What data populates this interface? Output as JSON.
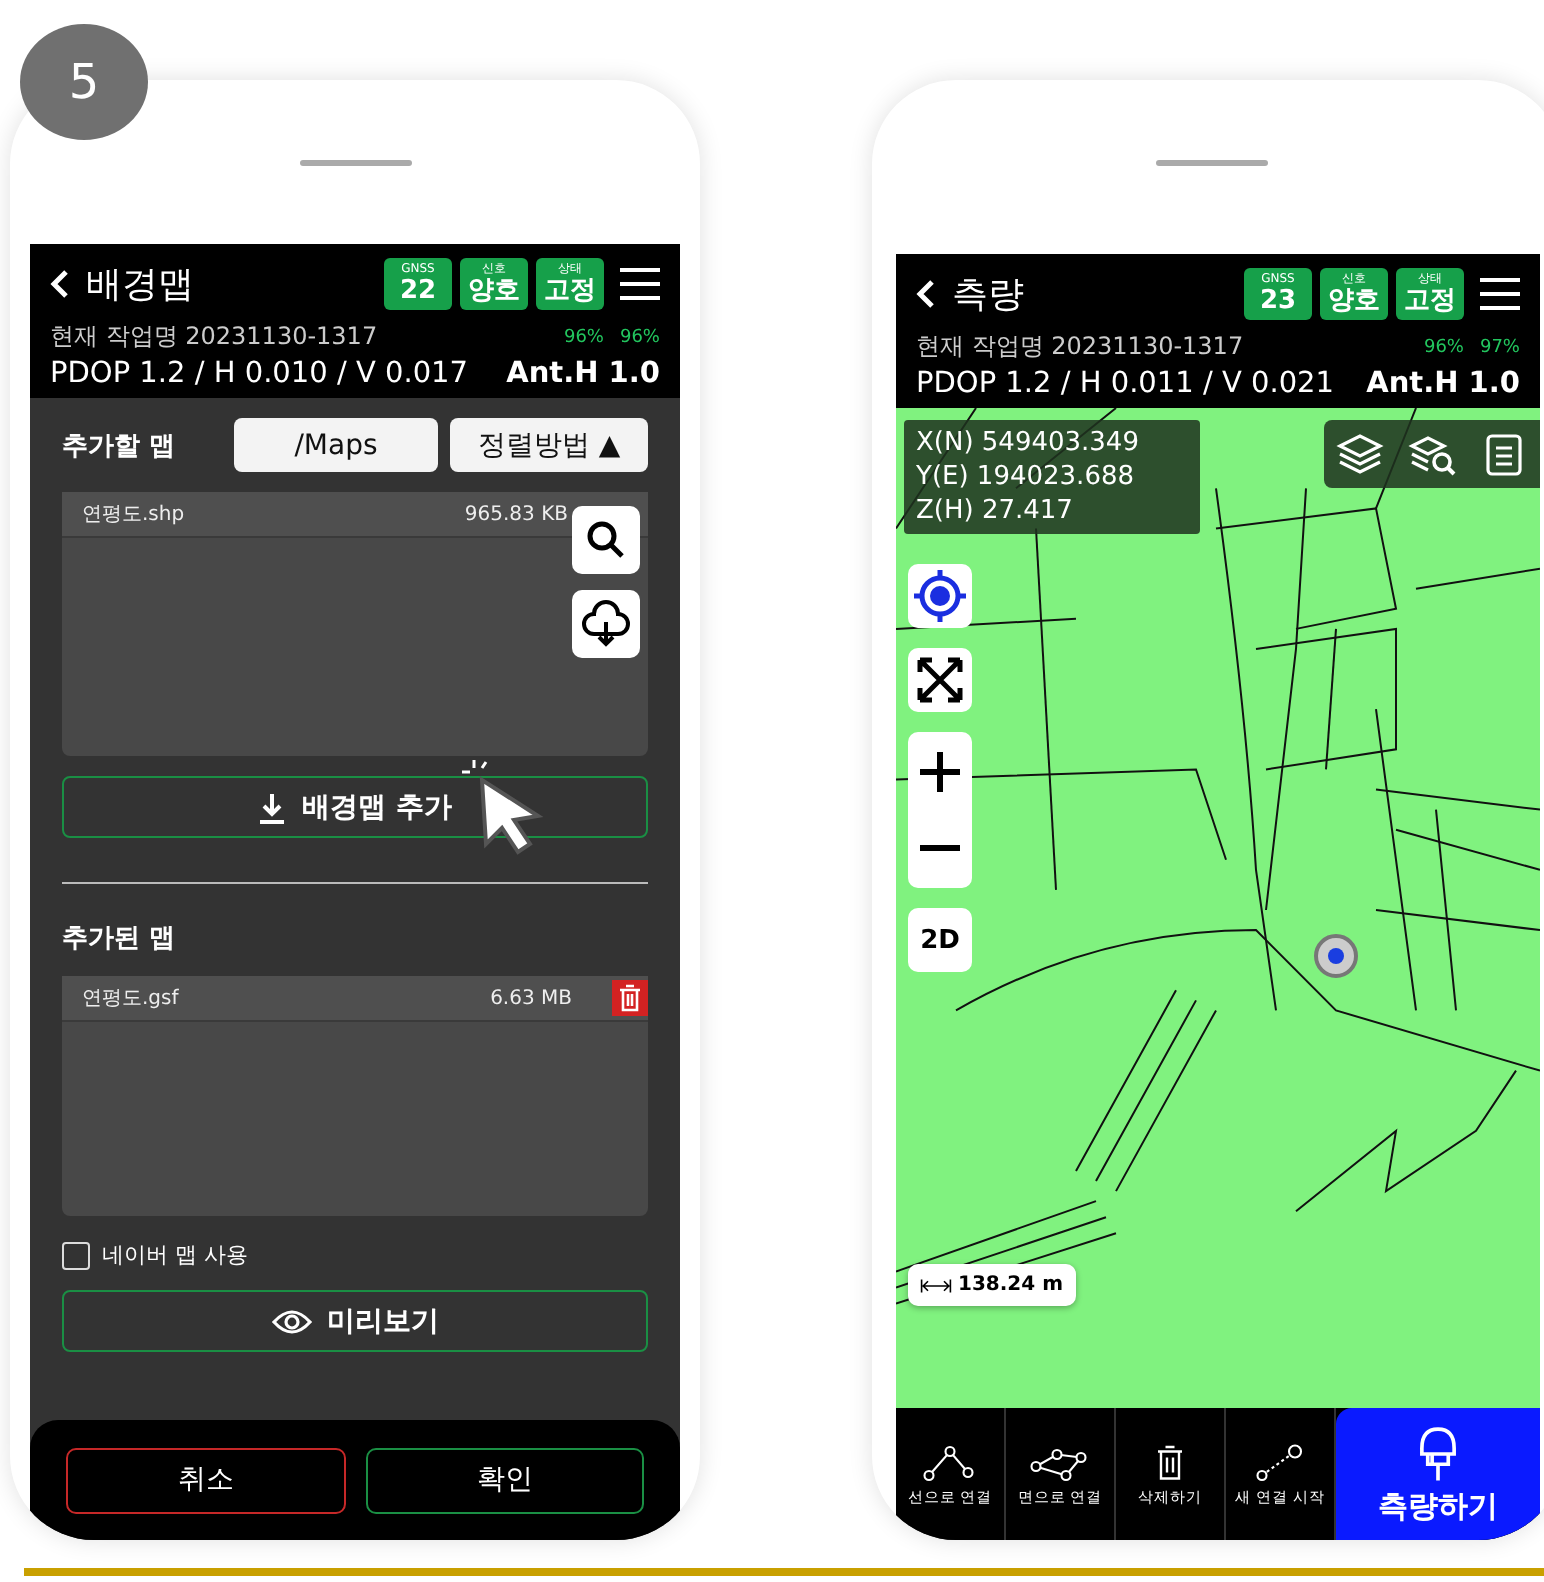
{
  "step_badge": "5",
  "left_screen": {
    "header": {
      "title": "배경맵",
      "status_badges": [
        {
          "label": "GNSS",
          "value": "22"
        },
        {
          "label": "신호",
          "value": "양호"
        },
        {
          "label": "상태",
          "value": "고정"
        }
      ],
      "job": "현재 작업명 20231130-1317",
      "wifi": "96%",
      "battery": "96%",
      "precision": "PDOP 1.2 / H 0.010 / V 0.017",
      "antenna": "Ant.H 1.0"
    },
    "add_section": {
      "title": "추가할 맵",
      "path_button": "/Maps",
      "sort_button": "정렬방법 ▲",
      "files": [
        {
          "name": "연평도.shp",
          "size": "965.83 KB"
        }
      ],
      "add_button": "배경맵 추가"
    },
    "added_section": {
      "title": "추가된 맵",
      "files": [
        {
          "name": "연평도.gsf",
          "size": "6.63 MB"
        }
      ]
    },
    "naver_checkbox": {
      "label": "네이버 맵 사용",
      "checked": false
    },
    "preview_button": "미리보기",
    "cancel_button": "취소",
    "confirm_button": "확인"
  },
  "right_screen": {
    "header": {
      "title": "측량",
      "status_badges": [
        {
          "label": "GNSS",
          "value": "23"
        },
        {
          "label": "신호",
          "value": "양호"
        },
        {
          "label": "상태",
          "value": "고정"
        }
      ],
      "job": "현재 작업명 20231130-1317",
      "wifi": "96%",
      "battery": "97%",
      "precision": "PDOP 1.2 / H 0.011 / V 0.021",
      "antenna": "Ant.H 1.0"
    },
    "coordinates": [
      "X(N) 549403.349",
      "Y(E) 194023.688",
      "Z(H) 27.417"
    ],
    "view_mode_button": "2D",
    "scale": "138.24 m",
    "toolbar": [
      {
        "kind": "line",
        "label": "선으로 연결"
      },
      {
        "kind": "polygon",
        "label": "면으로 연결"
      },
      {
        "kind": "delete",
        "label": "삭제하기"
      },
      {
        "kind": "new",
        "label": "새 연결 시작"
      }
    ],
    "measure_button": "측량하기"
  }
}
